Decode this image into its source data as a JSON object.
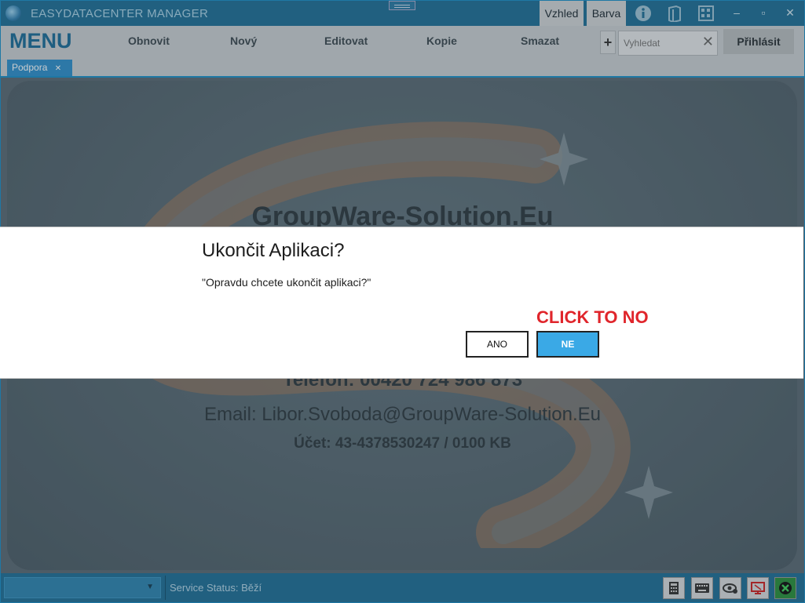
{
  "window": {
    "title": "EASYDATACENTER MANAGER",
    "tabs": [
      "Vzhled",
      "Barva"
    ],
    "controls": {
      "minimize": "–",
      "maximize": "▫",
      "close": "✕"
    },
    "icons": [
      "info-icon",
      "book-icon",
      "keyboard-icon"
    ]
  },
  "menu": {
    "label": "MENU",
    "items": [
      "Obnovit",
      "Nový",
      "Editovat",
      "Kopie",
      "Smazat"
    ],
    "add": "+",
    "search_placeholder": "Vyhledat",
    "login": "Přihlásit"
  },
  "doc_tab": {
    "label": "Podpora",
    "close": "✕"
  },
  "background": {
    "company": "GroupWare-Solution.Eu",
    "phone": "Telefon: 00420 724 986 873",
    "email": "Email: Libor.Svoboda@GroupWare-Solution.Eu",
    "account": "Účet: 43-4378530247 / 0100 KB"
  },
  "dialog": {
    "title": "Ukončit Aplikaci?",
    "message": "\"Opravdu chcete ukončit aplikaci?\"",
    "hint": "CLICK TO NO",
    "yes": "ANO",
    "no": "NE"
  },
  "status": {
    "label": "Service Status:",
    "value": "Běží"
  },
  "colors": {
    "accent": "#1b8fc9",
    "primary_button": "#3aa9e6",
    "hint": "#e0252b"
  }
}
